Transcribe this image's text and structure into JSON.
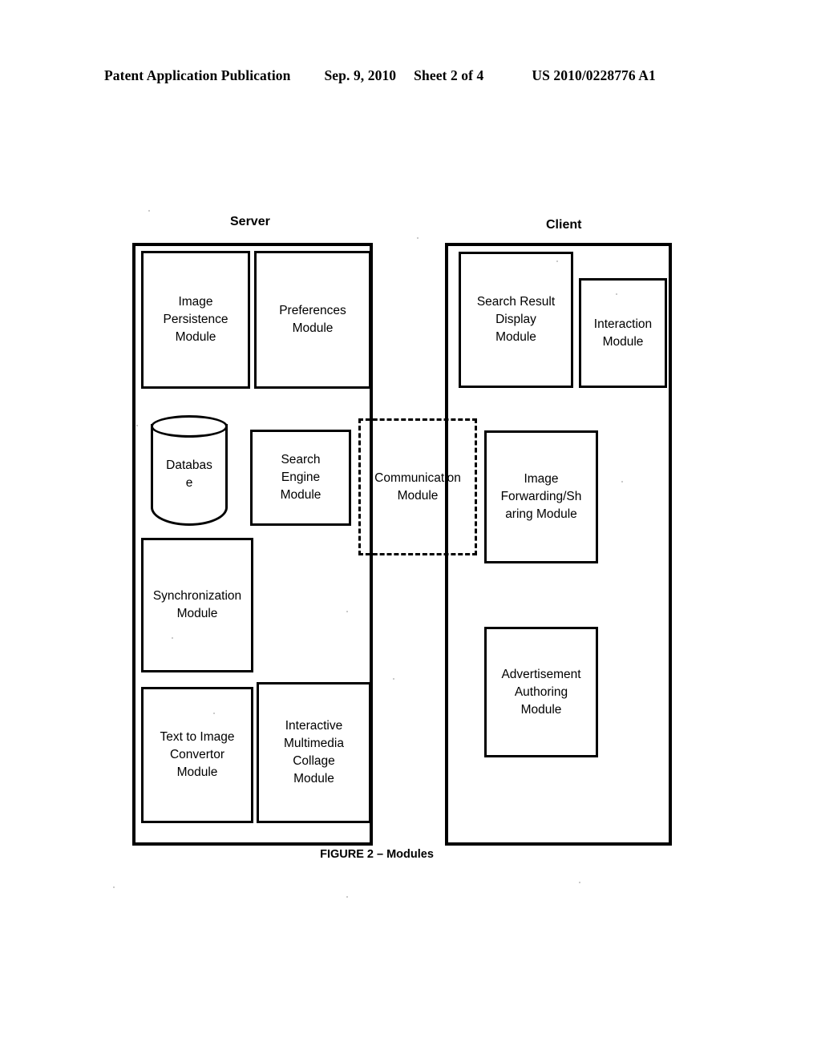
{
  "header": {
    "publication": "Patent Application Publication",
    "date": "Sep. 9, 2010",
    "sheet": "Sheet 2 of 4",
    "number": "US 2010/0228776 A1"
  },
  "figure": {
    "caption": "FIGURE 2 – Modules",
    "regions": [
      {
        "id": "server",
        "label": "Server"
      },
      {
        "id": "client",
        "label": "Client"
      }
    ],
    "server_modules": [
      {
        "id": "image-persistence",
        "label": "Image\nPersistence\nModule"
      },
      {
        "id": "preferences",
        "label": "Preferences\nModule"
      },
      {
        "id": "database",
        "label": "Databas\ne",
        "shape": "cylinder"
      },
      {
        "id": "search-engine",
        "label": "Search\nEngine\nModule"
      },
      {
        "id": "synchronization",
        "label": "Synchronization\nModule"
      },
      {
        "id": "text-to-image-convertor",
        "label": "Text to Image\nConvertor\nModule"
      },
      {
        "id": "interactive-multimedia-collage",
        "label": "Interactive\nMultimedia\nCollage\nModule"
      }
    ],
    "client_modules": [
      {
        "id": "search-result-display",
        "label": "Search Result\nDisplay\nModule"
      },
      {
        "id": "interaction",
        "label": "Interaction\nModule"
      },
      {
        "id": "image-forwarding-sharing",
        "label": "Image\nForwarding/Sh\naring Module"
      },
      {
        "id": "advertisement-authoring",
        "label": "Advertisement\nAuthoring\nModule"
      }
    ],
    "shared_modules": [
      {
        "id": "communication",
        "label": "Communicat​ion\nModule",
        "style": "dashed"
      }
    ]
  }
}
